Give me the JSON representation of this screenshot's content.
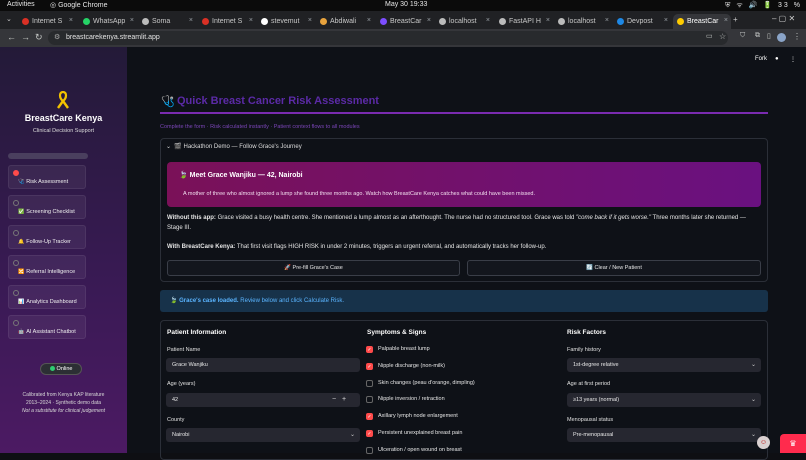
{
  "os": {
    "activities": "Activities",
    "app_name": "Google Chrome",
    "clock": "May 30  19:33",
    "battery": "33 %"
  },
  "tabs": [
    {
      "label": "Internet S",
      "color": "#d93025"
    },
    {
      "label": "WhatsApp",
      "color": "#25d366"
    },
    {
      "label": "Soma",
      "color": "#bbbbbb"
    },
    {
      "label": "Internet S",
      "color": "#d93025"
    },
    {
      "label": "stevemut",
      "color": "#ffffff"
    },
    {
      "label": "Abdiwali",
      "color": "#e8a33d"
    },
    {
      "label": "BreastCar",
      "color": "#7c4dff"
    },
    {
      "label": "localhost",
      "color": "#bbbbbb"
    },
    {
      "label": "FastAPI H",
      "color": "#bbbbbb"
    },
    {
      "label": "localhost",
      "color": "#bbbbbb"
    },
    {
      "label": "Devpost",
      "color": "#1e88e5"
    },
    {
      "label": "BreastCar",
      "color": "#ffcc00"
    }
  ],
  "address": {
    "url": "breastcarekenya.streamlit.app"
  },
  "sidebar": {
    "brand": "BreastCare Kenya",
    "subtitle": "Clinical Decision Support",
    "items": [
      {
        "label": "Risk Assessment",
        "icon": "🩺",
        "selected": true
      },
      {
        "label": "Screening Checklist",
        "icon": "✅",
        "selected": false
      },
      {
        "label": "Follow-Up Tracker",
        "icon": "🔔",
        "selected": false
      },
      {
        "label": "Referral Intelligence",
        "icon": "🔀",
        "selected": false
      },
      {
        "label": "Analytics Dashboard",
        "icon": "📊",
        "selected": false
      },
      {
        "label": "AI Assistant Chatbot",
        "icon": "🤖",
        "selected": false
      }
    ],
    "status": "Online",
    "calibration": [
      "Calibrated from Kenya KAP literature",
      "2013–2024 · Synthetic demo data",
      "Not a substitute for clinical judgement"
    ]
  },
  "header": {
    "fork": "Fork"
  },
  "main": {
    "title": "Quick Breast Cancer Risk Assessment",
    "subtitle": "Complete the form · Risk calculated instantly · Patient context flows to all modules",
    "expander_label": "🎬 Hackathon Demo — Follow Grace's Journey",
    "banner_title": "Meet Grace Wanjiku — 42, Nairobi",
    "banner_text": "A mother of three who almost ignored a lump she found three months ago. Watch how BreastCare Kenya catches what could have been missed.",
    "without_label": "Without this app:",
    "without_text": " Grace visited a busy health centre. She mentioned a lump almost as an afterthought. The nurse had no structured tool. Grace was told ",
    "without_quote": "\"come back if it gets worse.\"",
    "without_tail": " Three months later she returned — Stage III.",
    "with_label": "With BreastCare Kenya:",
    "with_text": " That first visit flags HIGH RISK in under 2 minutes, triggers an urgent referral, and automatically tracks her follow-up.",
    "prefill_button": "🚀 Pre-fill Grace's Case",
    "clear_button": "🔄 Clear / New Patient",
    "alert_bold": "Grace's case loaded.",
    "alert_text": " Review below and click Calculate Risk."
  },
  "form": {
    "patient_info": "Patient Information",
    "patient_name_label": "Patient Name",
    "patient_name": "Grace Wanjiku",
    "age_label": "Age (years)",
    "age": "42",
    "county_label": "County",
    "county": "Nairobi",
    "symptoms_title": "Symptoms & Signs",
    "symptoms": [
      {
        "label": "Palpable breast lump",
        "checked": true
      },
      {
        "label": "Nipple discharge (non-milk)",
        "checked": true
      },
      {
        "label": "Skin changes (peau d'orange, dimpling)",
        "checked": false
      },
      {
        "label": "Nipple inversion / retraction",
        "checked": false
      },
      {
        "label": "Axillary lymph node enlargement",
        "checked": true
      },
      {
        "label": "Persistent unexplained breast pain",
        "checked": true
      },
      {
        "label": "Ulceration / open wound on breast",
        "checked": false
      }
    ],
    "risk_title": "Risk Factors",
    "family_label": "Family history",
    "family": "1st-degree relative",
    "first_period_label": "Age at first period",
    "first_period": "≥13 years (normal)",
    "menopause_label": "Menopausal status",
    "menopause": "Pre-menopausal"
  },
  "colors": {
    "accent": "#ff4b4b",
    "brand_purple": "#5b2aa6"
  }
}
